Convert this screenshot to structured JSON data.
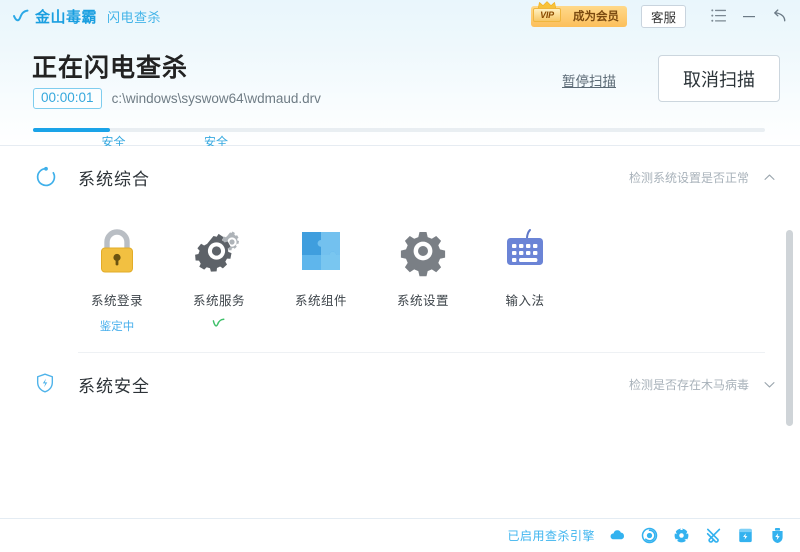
{
  "titlebar": {
    "brand_name": "金山毒霸",
    "brand_sub": "闪电查杀",
    "logo_icon": "swoosh-check-icon",
    "vip_text": "成为会员",
    "vip_badge_text": "VIP",
    "vip_badge_icon": "crown-icon",
    "support_button": "客服",
    "menu_icon": "hamburger-list-icon",
    "minimize_icon": "minimize-icon",
    "close_icon": "restore-back-arrow-icon"
  },
  "scan": {
    "title": "正在闪电查杀",
    "timer": "00:00:01",
    "path": "c:\\windows\\syswow64\\wdmaud.drv",
    "pause_label": "暂停扫描",
    "cancel_label": "取消扫描",
    "progress_percent": 10.5,
    "segments": [
      {
        "label": "安全",
        "position_percent": 11
      },
      {
        "label": "安全",
        "position_percent": 25
      }
    ]
  },
  "sections": [
    {
      "id": "system-overview",
      "icon": "loading-spinner-icon",
      "title": "系统综合",
      "description": "检测系统设置是否正常",
      "chevron": "chevron-up-icon",
      "expanded": true,
      "tiles": [
        {
          "icon": "padlock-icon",
          "label": "系统登录",
          "status": "鉴定中",
          "status_type": "scanning"
        },
        {
          "icon": "gears-icon",
          "label": "系统服务",
          "status": "",
          "status_type": "done"
        },
        {
          "icon": "puzzle-icon",
          "label": "系统组件",
          "status": "",
          "status_type": "none"
        },
        {
          "icon": "gear-icon",
          "label": "系统设置",
          "status": "",
          "status_type": "none"
        },
        {
          "icon": "keyboard-icon",
          "label": "输入法",
          "status": "",
          "status_type": "none"
        }
      ]
    },
    {
      "id": "system-security",
      "icon": "shield-bolt-icon",
      "title": "系统安全",
      "description": "检测是否存在木马病毒",
      "chevron": "chevron-down-icon",
      "expanded": false,
      "tiles": []
    }
  ],
  "footer": {
    "text": "已启用查杀引擎",
    "icons": [
      "cloud-icon",
      "vortex-icon",
      "globe-shield-icon",
      "tools-icon",
      "archive-box-icon",
      "usb-shield-icon"
    ]
  },
  "colors": {
    "accent": "#1aa3e8",
    "brand": "#1a9fe0",
    "vip_gold": "#fcbf5b",
    "success_green": "#3fc06a",
    "header_gradient_top": "#e9f6fc"
  }
}
